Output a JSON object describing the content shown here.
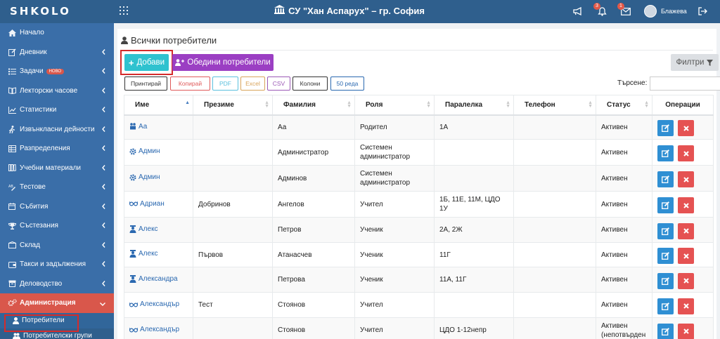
{
  "header": {
    "logo": "SHKOLO",
    "school_name": "СУ \"Хан Аспарух\" – гр. София",
    "bell_badge": "3",
    "mail_badge": "1",
    "user_name": "Блажева"
  },
  "sidebar": {
    "items": [
      {
        "label": "Начало",
        "icon": "home-icon"
      },
      {
        "label": "Дневник",
        "icon": "edit-icon"
      },
      {
        "label": "Задачи",
        "icon": "tasks-icon",
        "badge": "НОВО"
      },
      {
        "label": "Лекторски часове",
        "icon": "book-icon"
      },
      {
        "label": "Статистики",
        "icon": "chart-icon"
      },
      {
        "label": "Извънкласни дейности",
        "icon": "running-icon"
      },
      {
        "label": "Разпределения",
        "icon": "table-icon"
      },
      {
        "label": "Учебни материали",
        "icon": "materials-icon"
      },
      {
        "label": "Тестове",
        "icon": "test-icon"
      },
      {
        "label": "Събития",
        "icon": "calendar-icon"
      },
      {
        "label": "Състезания",
        "icon": "trophy-icon"
      },
      {
        "label": "Склад",
        "icon": "box-icon"
      },
      {
        "label": "Такси и задължения",
        "icon": "wallet-icon"
      },
      {
        "label": "Деловодство",
        "icon": "archive-icon"
      },
      {
        "label": "Администрация",
        "icon": "cogs-icon"
      }
    ],
    "sub_items": [
      {
        "label": "Потребители"
      },
      {
        "label": "Потребителски групи"
      }
    ]
  },
  "page": {
    "title": "Всички потребители",
    "add_button": "Добави",
    "merge_button": "Обедини потребители",
    "filters_button": "Филтри",
    "search_label": "Търсене:",
    "search_value": ""
  },
  "export_buttons": [
    "Принтирай",
    "Копирай",
    "PDF",
    "Excel",
    "CSV",
    "Колони",
    "50 реда"
  ],
  "export_colors": [
    "#333333",
    "#e05a5a",
    "#5bc0de",
    "#d9a45b",
    "#9b59b6",
    "#333333",
    "#2a68b0"
  ],
  "table": {
    "columns": [
      "Име",
      "Презиме",
      "Фамилия",
      "Роля",
      "Паралелка",
      "Телефон",
      "Статус",
      "Операции"
    ],
    "rows": [
      {
        "icon": "parent-icon",
        "name": "Аа",
        "middle": "",
        "last": "Аа",
        "role": "Родител",
        "class": "1А",
        "phone": "",
        "status": "Активен"
      },
      {
        "icon": "cog-icon",
        "name": "Админ",
        "middle": "",
        "last": "Администратор",
        "role": "Системен администратор",
        "class": "",
        "phone": "",
        "status": "Активен"
      },
      {
        "icon": "cog-icon",
        "name": "Админ",
        "middle": "",
        "last": "Админов",
        "role": "Системен администратор",
        "class": "",
        "phone": "",
        "status": "Активен"
      },
      {
        "icon": "glasses-icon",
        "name": "Адриан",
        "middle": "Добринов",
        "last": "Ангелов",
        "role": "Учител",
        "class": "1Б, 11Е, 11М, ЦДО 1У",
        "phone": "",
        "status": "Активен"
      },
      {
        "icon": "student-icon",
        "name": "Алекс",
        "middle": "",
        "last": "Петров",
        "role": "Ученик",
        "class": "2А, 2Ж",
        "phone": "",
        "status": "Активен"
      },
      {
        "icon": "student-icon",
        "name": "Алекс",
        "middle": "Първов",
        "last": "Атанасчев",
        "role": "Ученик",
        "class": "11Г",
        "phone": "",
        "status": "Активен"
      },
      {
        "icon": "student-icon",
        "name": "Александра",
        "middle": "",
        "last": "Петрова",
        "role": "Ученик",
        "class": "11А, 11Г",
        "phone": "",
        "status": "Активен"
      },
      {
        "icon": "glasses-icon",
        "name": "Александър",
        "middle": "Тест",
        "last": "Стоянов",
        "role": "Учител",
        "class": "",
        "phone": "",
        "status": "Активен"
      },
      {
        "icon": "glasses-icon",
        "name": "Александър",
        "middle": "",
        "last": "Стоянов",
        "role": "Учител",
        "class": "ЦДО 1-12непр",
        "phone": "",
        "status": "Активен (непотвърден"
      }
    ]
  },
  "colors": {
    "topbar": "#2f5f8d",
    "sidebar": "#3a6ea8",
    "sidebar_active": "#d9574b",
    "add_button": "#2fc2cf",
    "merge_button": "#9b3fc3",
    "edit_button": "#2f8fd3",
    "delete_button": "#e55252",
    "link": "#2a68b0"
  }
}
